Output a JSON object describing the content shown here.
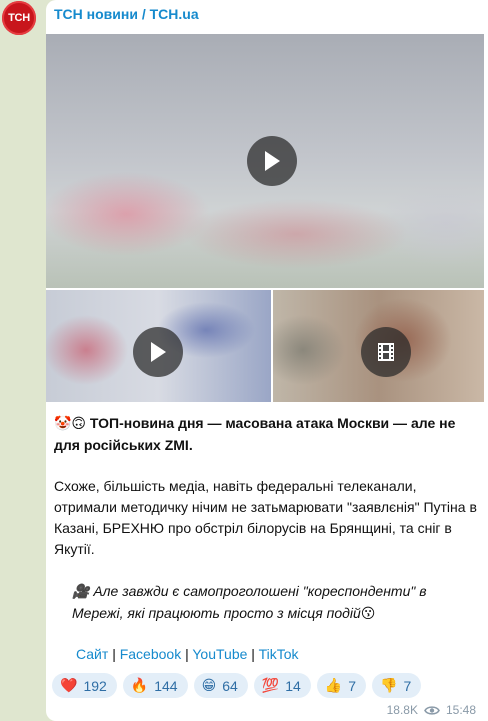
{
  "channel": {
    "avatar_text": "ТСН",
    "name": "ТСН новини / TCH.ua"
  },
  "post": {
    "headline_emoji": "🤡🙃",
    "headline": "ТОП-новина дня — масована атака Москви — але не для російських ZМІ.",
    "paragraph": "Схоже, більшість медіа, навіть федеральні телеканали, отримали методичку нічим не затьмарювати \"заявлєнія\" Путіна в Казані, БРЕХНЮ про обстріл білорусів на Брянщині, та сніг в Якутії.",
    "italic_emoji": "🎥",
    "italic_text": "Але завжди є самопроголошені \"кореспонденти\" в Мережі, які працюють просто з місця подій",
    "italic_end_emoji": "😗",
    "links": [
      "Сайт",
      "Facebook",
      "YouTube",
      "TikTok"
    ],
    "separator": "|"
  },
  "media": {
    "main": {
      "type": "video",
      "icon": "play-icon"
    },
    "left": {
      "type": "video",
      "icon": "play-icon"
    },
    "right": {
      "type": "video",
      "icon": "film-icon"
    }
  },
  "reactions": [
    {
      "emoji": "❤️",
      "count": "192"
    },
    {
      "emoji": "🔥",
      "count": "144"
    },
    {
      "emoji": "😁",
      "count": "64"
    },
    {
      "emoji": "💯",
      "count": "14"
    },
    {
      "emoji": "👍",
      "count": "7"
    },
    {
      "emoji": "👎",
      "count": "7"
    }
  ],
  "meta": {
    "views": "18.8K",
    "time": "15:48"
  }
}
